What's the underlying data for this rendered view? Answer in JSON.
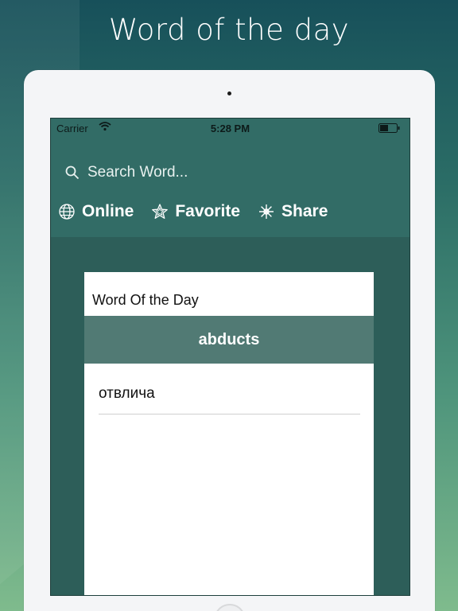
{
  "promo": {
    "title": "Word of the day"
  },
  "status_bar": {
    "carrier": "Carrier",
    "time": "5:28 PM"
  },
  "search": {
    "placeholder": "Search Word..."
  },
  "toolbar": {
    "items": [
      {
        "label": "Online",
        "icon": "globe-icon"
      },
      {
        "label": "Favorite",
        "icon": "star-icon"
      },
      {
        "label": "Share",
        "icon": "share-icon"
      }
    ]
  },
  "card": {
    "title": "Word Of the Day",
    "word": "abducts",
    "translation": "отвлича"
  },
  "colors": {
    "header": "#326c66",
    "screen_bg": "#2d5e59",
    "word_band": "#517a74"
  }
}
